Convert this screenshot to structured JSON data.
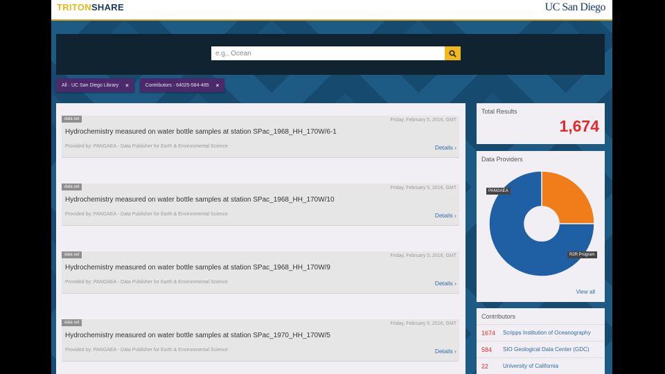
{
  "header": {
    "logo_part1": "TRITON",
    "logo_part2": "SHARE",
    "org_logo": "UC San Diego"
  },
  "search": {
    "placeholder": "e.g., Ocean",
    "value": "",
    "button_icon": "search-icon"
  },
  "filters": [
    {
      "label": "All · UC San Diego Library",
      "remove": "×"
    },
    {
      "label": "Contributors · 64025-584-485",
      "remove": "×"
    }
  ],
  "results": [
    {
      "type": "data set",
      "date": "Friday, February 5, 2016, GMT",
      "title": "Hydrochemistry measured on water bottle samples at station SPac_1968_HH_170W/6-1",
      "provider": "Provided by: PANGAEA - Data Publisher for Earth & Environmental Science",
      "details": "Details ›"
    },
    {
      "type": "data set",
      "date": "Friday, February 5, 2016, GMT",
      "title": "Hydrochemistry measured on water bottle samples at station SPac_1968_HH_170W/10",
      "provider": "Provided by: PANGAEA - Data Publisher for Earth & Environmental Science",
      "details": "Details ›"
    },
    {
      "type": "data set",
      "date": "Friday, February 5, 2016, GMT",
      "title": "Hydrochemistry measured on water bottle samples at station SPac_1968_HH_170W/9",
      "provider": "Provided by: PANGAEA - Data Publisher for Earth & Environmental Science",
      "details": "Details ›"
    },
    {
      "type": "data set",
      "date": "Friday, February 5, 2016, GMT",
      "title": "Hydrochemistry measured on water bottle samples at station SPac_1970_HH_170W/5",
      "provider": "Provided by: PANGAEA - Data Publisher for Earth & Environmental Science",
      "details": "Details ›"
    }
  ],
  "total": {
    "label": "Total Results",
    "value": "1,674"
  },
  "providers": {
    "label": "Data Providers",
    "view_all": "View all",
    "slices": [
      {
        "name": "PANGAEA",
        "fraction": 0.25,
        "color": "#f07d1a"
      },
      {
        "name": "R2R Program",
        "fraction": 0.75,
        "color": "#1f5fa3"
      }
    ]
  },
  "contributors": {
    "label": "Contributors",
    "items": [
      {
        "count": "1674",
        "name": "Scripps Institution of Oceanography"
      },
      {
        "count": "584",
        "name": "SIO Geological Data Center (GDC)"
      },
      {
        "count": "22",
        "name": "University of California"
      }
    ]
  },
  "colors": {
    "accent_gold": "#f1b81e",
    "brand_navy": "#173a63",
    "chip_purple": "#4b2a6b",
    "link_blue": "#2e6da4",
    "count_red": "#e02c2c"
  }
}
